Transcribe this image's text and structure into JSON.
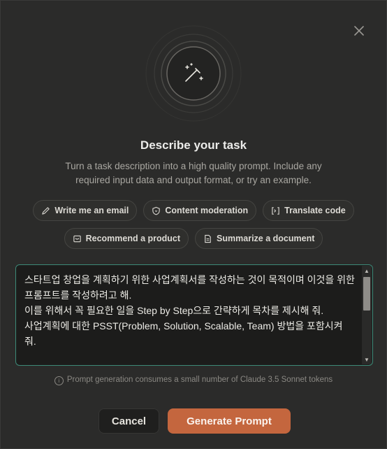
{
  "dialog": {
    "title": "Describe your task",
    "subtitle": "Turn a task description into a high quality prompt. Include any required input data and output format, or try an example."
  },
  "examples": {
    "row1": [
      {
        "label": "Write me an email",
        "icon": "pen-icon"
      },
      {
        "label": "Content moderation",
        "icon": "shield-icon"
      },
      {
        "label": "Translate code",
        "icon": "code-bracket-icon"
      }
    ],
    "row2": [
      {
        "label": "Recommend a product",
        "icon": "inbox-icon"
      },
      {
        "label": "Summarize a document",
        "icon": "document-icon"
      }
    ]
  },
  "task_input": {
    "value": "스타트업 창업을 계획하기 위한 사업계획서를 작성하는 것이 목적이며 이것을 위한 프롬프트를 작성하려고 해.\n이를 위해서 꼭 필요한 일을 Step by Step으로 간략하게 목차를 제시해 줘.\n사업계획에 대한 PSST(Problem, Solution, Scalable, Team) 방법을 포함시켜 줘.\n\n내 페르소나를 설정하고 싶어. 너는 나의 페르소나를 설정하기 위한 간단한"
  },
  "note": "Prompt generation consumes a small number of Claude 3.5 Sonnet tokens",
  "buttons": {
    "cancel": "Cancel",
    "generate": "Generate Prompt"
  },
  "colors": {
    "background": "#2b2b2a",
    "accent": "#c4663e",
    "focus_border": "#3d8a78"
  }
}
